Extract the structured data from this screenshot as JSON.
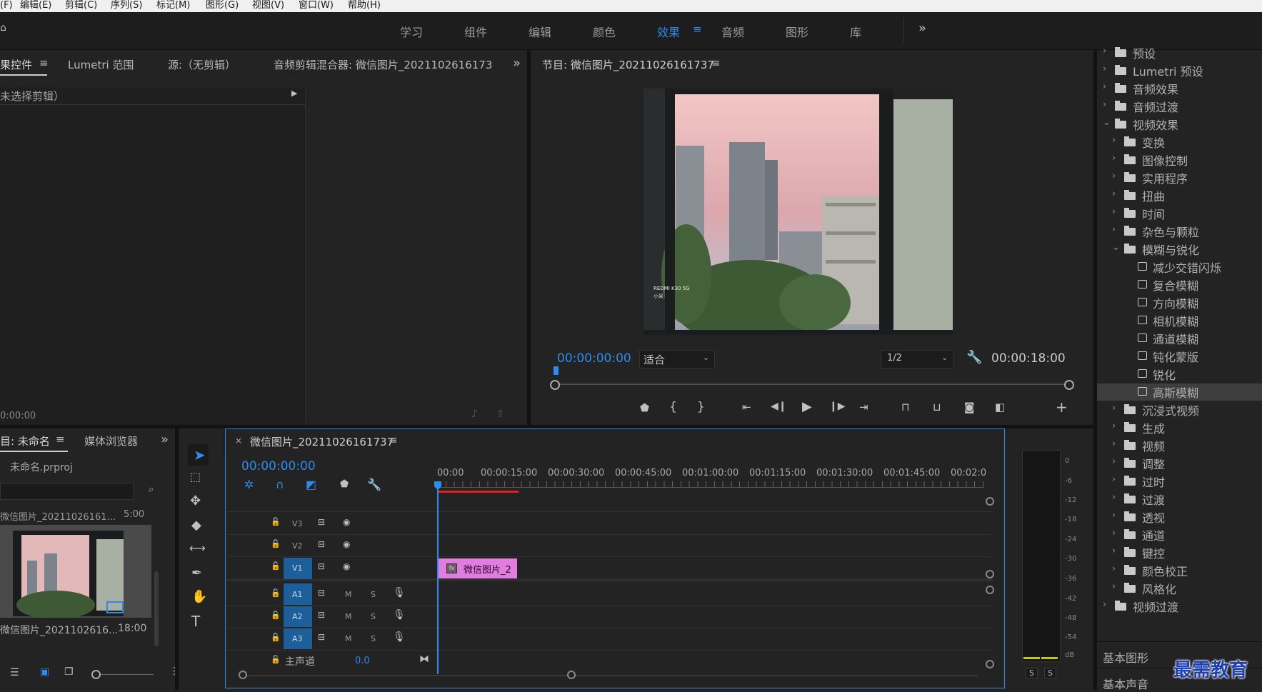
{
  "menu": [
    "(F)",
    "编辑(E)",
    "剪辑(C)",
    "序列(S)",
    "标记(M)",
    "图形(G)",
    "视图(V)",
    "窗口(W)",
    "帮助(H)"
  ],
  "workspaces": [
    "学习",
    "组件",
    "编辑",
    "颜色",
    "效果",
    "音频",
    "图形",
    "库"
  ],
  "active_workspace": "效果",
  "source_panel": {
    "tabs": [
      "果控件",
      "Lumetri 范围",
      "源:（无剪辑）",
      "音频剪辑混合器: 微信图片_2021102616173"
    ],
    "no_clip": "未选择剪辑）",
    "timecode": "0:00:00"
  },
  "program": {
    "title": "节目: 微信图片_20211026161737",
    "timecode": "00:00:00:00",
    "fit": "适合",
    "resolution": "1/2",
    "duration": "00:00:18:00",
    "watermark_line1": "REDMI K30 5G",
    "watermark_line2": "小米"
  },
  "project": {
    "tabs": [
      "目: 未命名",
      "媒体浏览器"
    ],
    "file": "未命名.prproj",
    "item_top": "微信图片_20211026161...",
    "item_top_dur": "5:00",
    "item_name": "微信图片_2021102616...",
    "item_dur": "18:00"
  },
  "timeline": {
    "title": "微信图片_20211026161737",
    "timecode": "00:00:00:00",
    "ruler": [
      "00:00",
      "00:00:15:00",
      "00:00:30:00",
      "00:00:45:00",
      "00:01:00:00",
      "00:01:15:00",
      "00:01:30:00",
      "00:01:45:00",
      "00:02:0"
    ],
    "video_tracks": [
      "V3",
      "V2",
      "V1"
    ],
    "audio_tracks": [
      "A1",
      "A2",
      "A3"
    ],
    "master": "主声道",
    "master_value": "0.0",
    "clip_label": "微信图片_2",
    "m": "M",
    "s": "S"
  },
  "meter": {
    "labels": [
      "0",
      "-6",
      "-12",
      "-18",
      "-24",
      "-30",
      "-36",
      "-42",
      "-48",
      "-54",
      "dB"
    ],
    "solo": "S"
  },
  "effects_tree": [
    {
      "label": "预设",
      "level": 0,
      "kind": "folder",
      "open": false
    },
    {
      "label": "Lumetri 预设",
      "level": 0,
      "kind": "folder",
      "open": false
    },
    {
      "label": "音频效果",
      "level": 0,
      "kind": "folder",
      "open": false
    },
    {
      "label": "音频过渡",
      "level": 0,
      "kind": "folder",
      "open": false
    },
    {
      "label": "视频效果",
      "level": 0,
      "kind": "folder",
      "open": true
    },
    {
      "label": "变换",
      "level": 1,
      "kind": "folder",
      "open": false
    },
    {
      "label": "图像控制",
      "level": 1,
      "kind": "folder",
      "open": false
    },
    {
      "label": "实用程序",
      "level": 1,
      "kind": "folder",
      "open": false
    },
    {
      "label": "扭曲",
      "level": 1,
      "kind": "folder",
      "open": false
    },
    {
      "label": "时间",
      "level": 1,
      "kind": "folder",
      "open": false
    },
    {
      "label": "杂色与颗粒",
      "level": 1,
      "kind": "folder",
      "open": false
    },
    {
      "label": "模糊与锐化",
      "level": 1,
      "kind": "folder",
      "open": true
    },
    {
      "label": "减少交错闪烁",
      "level": 2,
      "kind": "effect"
    },
    {
      "label": "复合模糊",
      "level": 2,
      "kind": "effect"
    },
    {
      "label": "方向模糊",
      "level": 2,
      "kind": "effect"
    },
    {
      "label": "相机模糊",
      "level": 2,
      "kind": "effect"
    },
    {
      "label": "通道模糊",
      "level": 2,
      "kind": "effect"
    },
    {
      "label": "钝化蒙版",
      "level": 2,
      "kind": "effect"
    },
    {
      "label": "锐化",
      "level": 2,
      "kind": "effect"
    },
    {
      "label": "高斯模糊",
      "level": 2,
      "kind": "effect",
      "selected": true
    },
    {
      "label": "沉浸式视频",
      "level": 1,
      "kind": "folder",
      "open": false
    },
    {
      "label": "生成",
      "level": 1,
      "kind": "folder",
      "open": false
    },
    {
      "label": "视频",
      "level": 1,
      "kind": "folder",
      "open": false
    },
    {
      "label": "调整",
      "level": 1,
      "kind": "folder",
      "open": false
    },
    {
      "label": "过时",
      "level": 1,
      "kind": "folder",
      "open": false
    },
    {
      "label": "过渡",
      "level": 1,
      "kind": "folder",
      "open": false
    },
    {
      "label": "透视",
      "level": 1,
      "kind": "folder",
      "open": false
    },
    {
      "label": "通道",
      "level": 1,
      "kind": "folder",
      "open": false
    },
    {
      "label": "键控",
      "level": 1,
      "kind": "folder",
      "open": false
    },
    {
      "label": "颜色校正",
      "level": 1,
      "kind": "folder",
      "open": false
    },
    {
      "label": "风格化",
      "level": 1,
      "kind": "folder",
      "open": false
    },
    {
      "label": "视频过渡",
      "level": 0,
      "kind": "folder",
      "open": false
    }
  ],
  "bottom_panels": [
    "基本图形",
    "基本声音"
  ],
  "brand": "最需教育",
  "colors": {
    "accent": "#2d8ceb",
    "clip": "#e27de0",
    "playhead": "#2d8ceb",
    "workarea": "#e02020"
  }
}
